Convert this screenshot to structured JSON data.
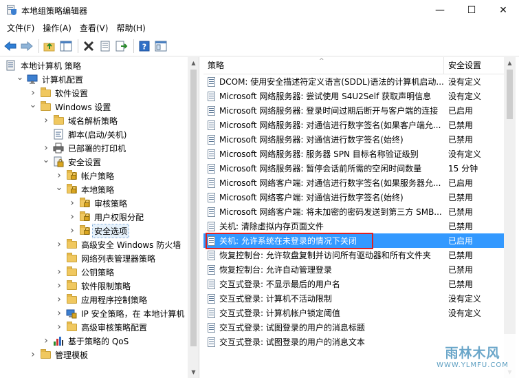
{
  "window": {
    "title": "本地组策略编辑器",
    "minimize_glyph": "—",
    "maximize_glyph": "☐",
    "close_glyph": "✕"
  },
  "menu": {
    "file": "文件(F)",
    "action": "操作(A)",
    "view": "查看(V)",
    "help": "帮助(H)"
  },
  "toolbar": {
    "icons": [
      "back-arrow-icon",
      "forward-arrow-icon",
      "up-folder-icon",
      "show-hide-tree-icon",
      "delete-icon",
      "properties-icon",
      "export-list-icon",
      "help-icon",
      "show-view-icon"
    ]
  },
  "tree": {
    "items": [
      {
        "label": "本地计算机 策略",
        "depth": 0,
        "chevron": "",
        "icon": "computer-policy"
      },
      {
        "label": "计算机配置",
        "depth": 1,
        "chevron": "down",
        "icon": "computer"
      },
      {
        "label": "软件设置",
        "depth": 2,
        "chevron": "right",
        "icon": "folder"
      },
      {
        "label": "Windows 设置",
        "depth": 2,
        "chevron": "down",
        "icon": "folder"
      },
      {
        "label": "域名解析策略",
        "depth": 3,
        "chevron": "right",
        "icon": "folder"
      },
      {
        "label": "脚本(启动/关机)",
        "depth": 3,
        "chevron": "",
        "icon": "script"
      },
      {
        "label": "已部署的打印机",
        "depth": 3,
        "chevron": "right",
        "icon": "printer"
      },
      {
        "label": "安全设置",
        "depth": 3,
        "chevron": "down",
        "icon": "security"
      },
      {
        "label": "帐户策略",
        "depth": 4,
        "chevron": "right",
        "icon": "lock-folder"
      },
      {
        "label": "本地策略",
        "depth": 4,
        "chevron": "down",
        "icon": "lock-folder"
      },
      {
        "label": "审核策略",
        "depth": 5,
        "chevron": "right",
        "icon": "lock-folder"
      },
      {
        "label": "用户权限分配",
        "depth": 5,
        "chevron": "right",
        "icon": "lock-folder"
      },
      {
        "label": "安全选项",
        "depth": 5,
        "chevron": "right",
        "icon": "lock-folder",
        "selected": true
      },
      {
        "label": "高级安全 Windows 防火墙",
        "depth": 4,
        "chevron": "right",
        "icon": "folder"
      },
      {
        "label": "网络列表管理器策略",
        "depth": 4,
        "chevron": "",
        "icon": "folder"
      },
      {
        "label": "公钥策略",
        "depth": 4,
        "chevron": "right",
        "icon": "folder"
      },
      {
        "label": "软件限制策略",
        "depth": 4,
        "chevron": "right",
        "icon": "folder"
      },
      {
        "label": "应用程序控制策略",
        "depth": 4,
        "chevron": "right",
        "icon": "folder"
      },
      {
        "label": "IP 安全策略，在 本地计算机",
        "depth": 4,
        "chevron": "right",
        "icon": "ip-security"
      },
      {
        "label": "高级审核策略配置",
        "depth": 4,
        "chevron": "right",
        "icon": "folder"
      },
      {
        "label": "基于策略的 QoS",
        "depth": 3,
        "chevron": "right",
        "icon": "qos-chart"
      },
      {
        "label": "管理模板",
        "depth": 2,
        "chevron": "right",
        "icon": "folder"
      }
    ]
  },
  "list": {
    "columns": {
      "policy": "策略",
      "setting": "安全设置"
    },
    "sort_glyph": "^",
    "rows": [
      {
        "policy": "DCOM: 使用安全描述符定义语言(SDDL)语法的计算机启动...",
        "setting": "没有定义"
      },
      {
        "policy": "Microsoft 网络服务器: 尝试使用 S4U2Self 获取声明信息",
        "setting": "没有定义"
      },
      {
        "policy": "Microsoft 网络服务器: 登录时间过期后断开与客户端的连接",
        "setting": "已启用"
      },
      {
        "policy": "Microsoft 网络服务器: 对通信进行数字签名(如果客户端允...",
        "setting": "已禁用"
      },
      {
        "policy": "Microsoft 网络服务器: 对通信进行数字签名(始终)",
        "setting": "已禁用"
      },
      {
        "policy": "Microsoft 网络服务器: 服务器 SPN 目标名称验证级别",
        "setting": "没有定义"
      },
      {
        "policy": "Microsoft 网络服务器: 暂停会话前所需的空闲时间数量",
        "setting": "15 分钟"
      },
      {
        "policy": "Microsoft 网络客户端: 对通信进行数字签名(如果服务器允...",
        "setting": "已启用"
      },
      {
        "policy": "Microsoft 网络客户端: 对通信进行数字签名(始终)",
        "setting": "已禁用"
      },
      {
        "policy": "Microsoft 网络客户端: 将未加密的密码发送到第三方 SMB...",
        "setting": "已禁用"
      },
      {
        "policy": "关机: 清除虚拟内存页面文件",
        "setting": "已禁用"
      },
      {
        "policy": "关机: 允许系统在未登录的情况下关闭",
        "setting": "已启用",
        "selected": true
      },
      {
        "policy": "恢复控制台: 允许软盘复制并访问所有驱动器和所有文件夹",
        "setting": "已禁用"
      },
      {
        "policy": "恢复控制台: 允许自动管理登录",
        "setting": "已禁用"
      },
      {
        "policy": "交互式登录: 不显示最后的用户名",
        "setting": "已禁用"
      },
      {
        "policy": "交互式登录: 计算机不活动限制",
        "setting": "没有定义"
      },
      {
        "policy": "交互式登录: 计算机帐户锁定阈值",
        "setting": "没有定义"
      },
      {
        "policy": "交互式登录: 试图登录的用户的消息标题",
        "setting": ""
      },
      {
        "policy": "交互式登录: 试图登录的用户的消息文本",
        "setting": ""
      }
    ]
  },
  "watermark": {
    "main": "雨林木风",
    "sub": "WWW.YLMFU.COM"
  },
  "colors": {
    "selection": "#3399ff",
    "highlight_box": "#e02020",
    "folder": "#f0c860"
  }
}
